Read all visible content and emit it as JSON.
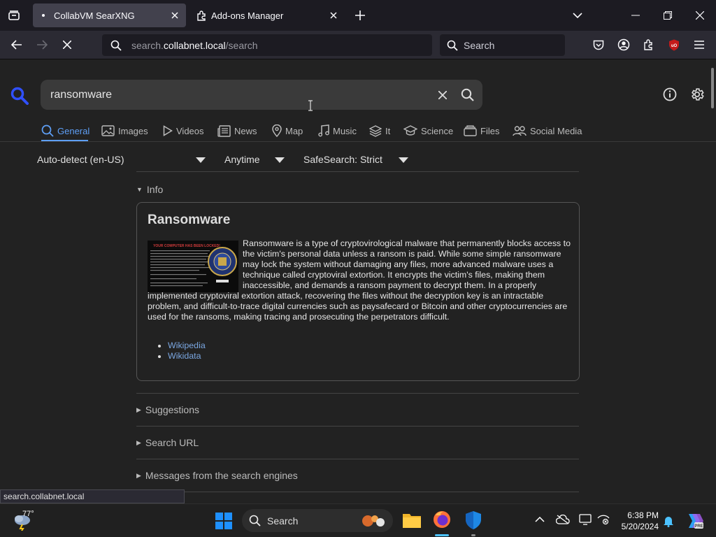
{
  "tabs": [
    {
      "title": "CollabVM SearXNG",
      "active": true
    },
    {
      "title": "Add-ons Manager",
      "active": false
    }
  ],
  "urlbar": {
    "url_host": "search.collabnet.local",
    "url_path": "/search",
    "url_prefix": "search.",
    "url_domain": "collabnet.local"
  },
  "toolbar_search": {
    "placeholder": "Search"
  },
  "search": {
    "query": "ransomware"
  },
  "categories": [
    {
      "label": "General",
      "icon": "search-icon",
      "active": true
    },
    {
      "label": "Images",
      "icon": "image-icon"
    },
    {
      "label": "Videos",
      "icon": "play-icon"
    },
    {
      "label": "News",
      "icon": "newspaper-icon"
    },
    {
      "label": "Map",
      "icon": "map-pin-icon"
    },
    {
      "label": "Music",
      "icon": "music-icon"
    },
    {
      "label": "It",
      "icon": "layers-icon"
    },
    {
      "label": "Science",
      "icon": "school-icon"
    },
    {
      "label": "Files",
      "icon": "files-icon"
    },
    {
      "label": "Social Media",
      "icon": "people-icon"
    }
  ],
  "filters": {
    "language": "Auto-detect (en-US)",
    "time": "Anytime",
    "safesearch": "SafeSearch: Strict"
  },
  "info": {
    "summary": "Info",
    "title": "Ransomware",
    "text": "Ransomware is a type of cryptovirological malware that permanently blocks access to the victim's personal data unless a ransom is paid. While some simple ransomware may lock the system without damaging any files, more advanced malware uses a technique called cryptoviral extortion. It encrypts the victim's files, making them inaccessible, and demands a ransom payment to decrypt them. In a properly implemented cryptoviral extortion attack, recovering the files without the decryption key is an intractable problem, and difficult-to-trace digital currencies such as paysafecard or Bitcoin and other cryptocurrencies are used for the ransoms, making tracing and prosecuting the perpetrators difficult.",
    "image_caption": "YOUR COMPUTER HAS BEEN LOCKED!",
    "links": [
      "Wikipedia",
      "Wikidata"
    ]
  },
  "sections": [
    "Suggestions",
    "Search URL",
    "Messages from the search engines"
  ],
  "status": "search.collabnet.local",
  "taskbar": {
    "weather": "77°",
    "search": "Search",
    "time": "6:38 PM",
    "date": "5/20/2024",
    "pre_badge": "PRE"
  },
  "colors": {
    "accent": "#5e9ff6",
    "link": "#7aa6e0",
    "ublock": "#c41a1a"
  }
}
